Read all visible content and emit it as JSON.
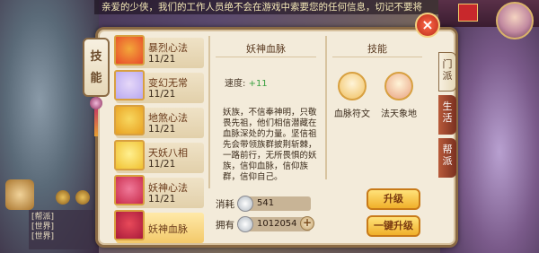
{
  "ticker": {
    "text": "亲爱的少侠，我们的工作人员绝不会在游戏中索要您的任何信息，切记不要将"
  },
  "panel": {
    "hang_label": "技能"
  },
  "close_glyph": "×",
  "list": [
    {
      "name": "暴烈心法",
      "level": "11/21",
      "colors": [
        "#e84a2a",
        "#f3a83a"
      ]
    },
    {
      "name": "变幻无常",
      "level": "11/21",
      "colors": [
        "#b8a8f0",
        "#e6d8f8"
      ]
    },
    {
      "name": "地煞心法",
      "level": "11/21",
      "colors": [
        "#e8a020",
        "#f8d860"
      ]
    },
    {
      "name": "天妖八相",
      "level": "11/21",
      "colors": [
        "#f0c030",
        "#fff090"
      ]
    },
    {
      "name": "妖神心法",
      "level": "11/21",
      "colors": [
        "#c82a4a",
        "#f07a9a"
      ]
    },
    {
      "name": "妖神血脉",
      "level": "",
      "colors": [
        "#a81a3a",
        "#e84a5a"
      ]
    }
  ],
  "detail": {
    "title": "妖神血脉",
    "speed_label": "速度:",
    "speed_value": "+11",
    "description": "妖族，不信奉神明，只敬畏先祖，他们相信潜藏在血脉深处的力量。坚信祖先会带领族群披荆斩棘，一路前行，无所畏惧的妖族，信仰血脉，信仰族群，信仰自己。"
  },
  "skills": {
    "title": "技能",
    "items": [
      {
        "label": "血脉符文",
        "icon": "rune-icon",
        "color": "#f0c060"
      },
      {
        "label": "法天象地",
        "icon": "giant-icon",
        "color": "#e8a080"
      }
    ]
  },
  "tabs": [
    "门派",
    "生活",
    "帮派"
  ],
  "cost": {
    "consume_label": "消耗",
    "consume_value": "541",
    "own_label": "拥有",
    "own_value": "1012054"
  },
  "buttons": {
    "upgrade": "升级",
    "upgrade_all": "一键升级"
  },
  "hud": {
    "lines": [
      "[帮派]",
      "[世界]",
      "[世界]"
    ]
  }
}
